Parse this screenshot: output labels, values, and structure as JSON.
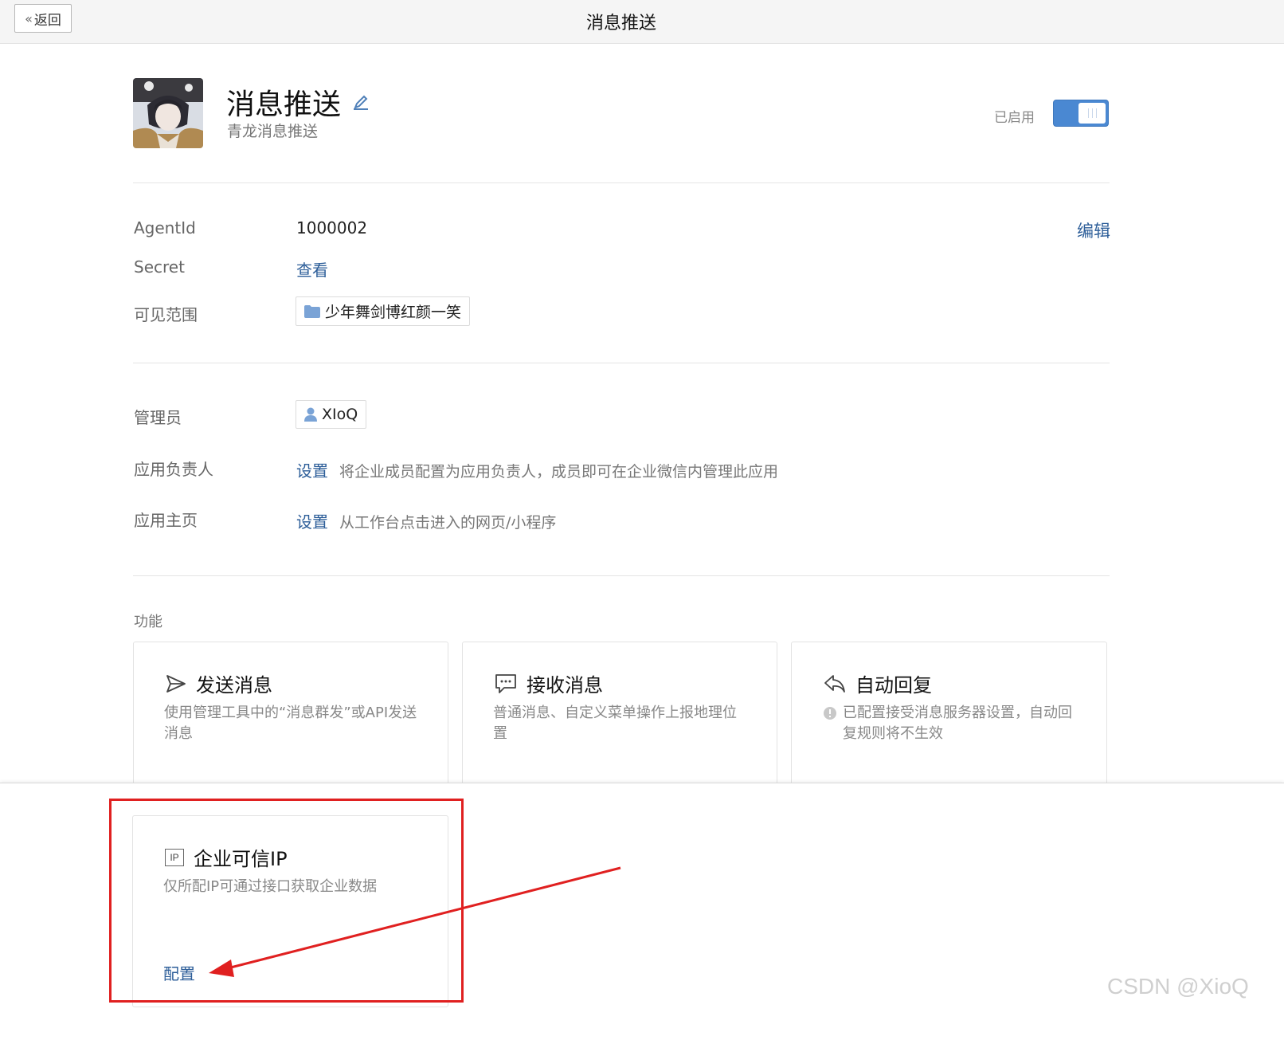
{
  "topbar": {
    "back_label": "返回",
    "title": "消息推送"
  },
  "app": {
    "name": "消息推送",
    "desc": "青龙消息推送",
    "status_label": "已启用",
    "enabled": true
  },
  "info": {
    "agentid_label": "AgentId",
    "agentid_value": "1000002",
    "edit_label": "编辑",
    "secret_label": "Secret",
    "secret_action": "查看",
    "scope_label": "可见范围",
    "scope_value": "少年舞剑博红颜一笑"
  },
  "admin": {
    "admin_label": "管理员",
    "admin_value": "XIoQ",
    "owner_label": "应用负责人",
    "owner_action": "设置",
    "owner_hint": "将企业成员配置为应用负责人，成员即可在企业微信内管理此应用",
    "homepage_label": "应用主页",
    "homepage_action": "设置",
    "homepage_hint": "从工作台点击进入的网页/小程序"
  },
  "features": {
    "section_label": "功能",
    "cards": [
      {
        "title": "发送消息",
        "desc": "使用管理工具中的“消息群发”或API发送消息",
        "icon": "send-icon"
      },
      {
        "title": "接收消息",
        "desc": "普通消息、自定义菜单操作上报地理位置",
        "icon": "chat-bubble-icon"
      },
      {
        "title": "自动回复",
        "desc": "已配置接受消息服务器设置，自动回复规则将不生效",
        "icon": "reply-icon"
      }
    ]
  },
  "trusted_ip": {
    "icon_text": "IP",
    "title": "企业可信IP",
    "desc": "仅所配IP可通过接口获取企业数据",
    "action": "配置"
  },
  "annotation_color": "#e02020",
  "link_color": "#2d5e99",
  "watermark": "CSDN @XioQ"
}
